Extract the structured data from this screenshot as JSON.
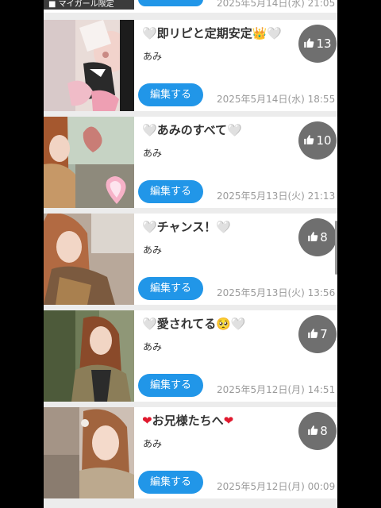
{
  "top_partial": {
    "label": "■ マイガール限定",
    "date": "2025年5月14日(水) 21:05"
  },
  "posts": [
    {
      "title_parts": [
        "🤍",
        "即リピと定期安定👑",
        "🤍"
      ],
      "heart_style": "white",
      "author": "あみ",
      "edit_label": "編集する",
      "date": "2025年5月14日(水) 18:55",
      "likes": "13",
      "thumb_icon": "thumbs-up-icon"
    },
    {
      "title_parts": [
        "🤍",
        "あみのすべて",
        "🤍"
      ],
      "heart_style": "white",
      "author": "あみ",
      "edit_label": "編集する",
      "date": "2025年5月13日(火) 21:13",
      "likes": "10",
      "thumb_icon": "thumbs-up-icon"
    },
    {
      "title_parts": [
        "🤍",
        "チャンス！",
        "🤍"
      ],
      "heart_style": "white",
      "author": "あみ",
      "edit_label": "編集する",
      "date": "2025年5月13日(火) 13:56",
      "likes": "8",
      "thumb_icon": "thumbs-up-icon"
    },
    {
      "title_parts": [
        "🤍",
        "愛されてる🥺",
        "🤍"
      ],
      "heart_style": "white",
      "author": "あみ",
      "edit_label": "編集する",
      "date": "2025年5月12日(月) 14:51",
      "likes": "7",
      "thumb_icon": "thumbs-up-icon"
    },
    {
      "title_parts": [
        "❤",
        "お兄様たちへ",
        "❤"
      ],
      "heart_style": "red",
      "author": "あみ",
      "edit_label": "編集する",
      "date": "2025年5月12日(月) 00:09",
      "likes": "8",
      "thumb_icon": "thumbs-up-icon"
    }
  ],
  "colors": {
    "accent": "#2196e8",
    "like_badge": "#6f6f6f",
    "date_text": "#9a9a9a",
    "background": "#ececec"
  }
}
